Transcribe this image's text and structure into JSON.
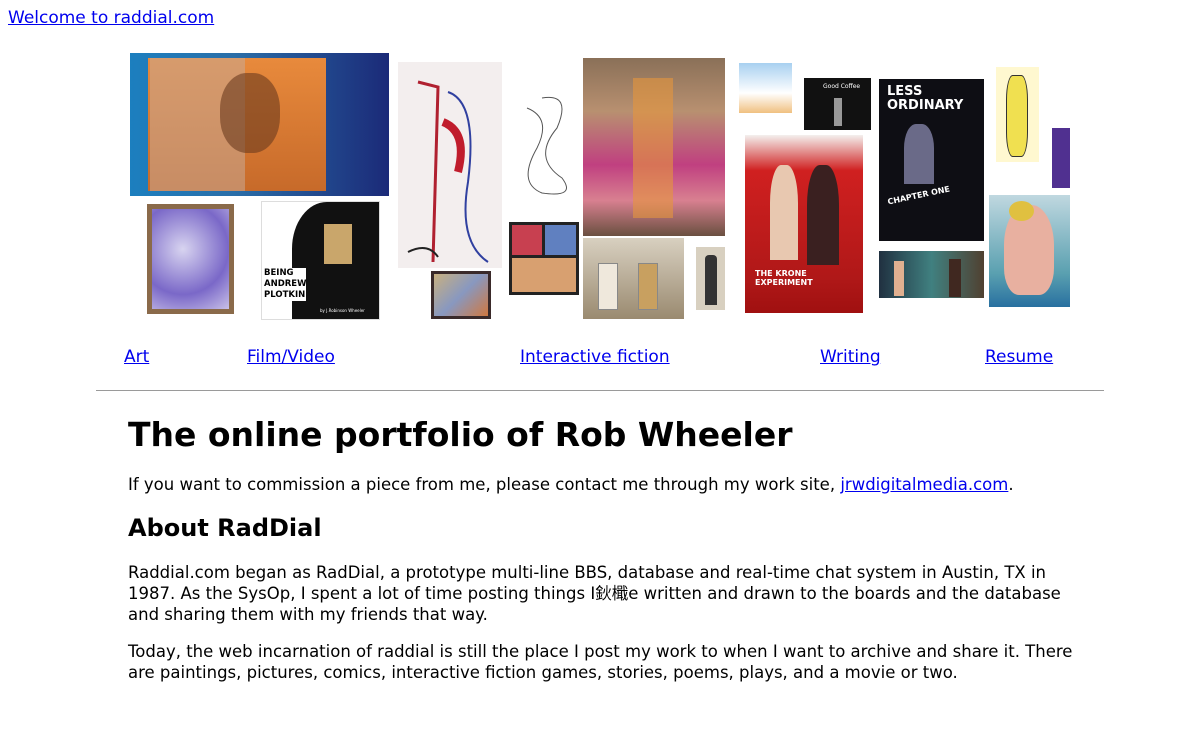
{
  "top_link": "Welcome to  raddial.com",
  "collage": {
    "plotkin_text": "BEING\nANDREW\nPLOTKIN",
    "plotkin_byline": "by J.Robinson Wheeler",
    "coffee_text": "Good Coffee",
    "krone_text": "THE KRONE EXPERIMENT",
    "less_ordinary_title": "LESS ORDINARY",
    "less_ordinary_sub": "CHAPTER ONE"
  },
  "nav": {
    "art": "Art",
    "film": "Film/Video",
    "if": "Interactive fiction",
    "writing": "Writing",
    "resume": "Resume"
  },
  "main": {
    "title": "The online portfolio of Rob Wheeler",
    "commission_before": "If you want to commission a piece from me, please contact me through my work site, ",
    "commission_link": "jrwdigitalmedia.com",
    "commission_after": ".",
    "about_heading": "About RadDial",
    "about_p1": "Raddial.com began as RadDial, a prototype multi-line BBS, database and real-time chat system in Austin, TX in 1987. As the SysOp, I spent a lot of time posting things I鈥檝e written and drawn to the boards and the database and sharing them with my friends that way.",
    "about_p2": "Today, the web incarnation of raddial is still the place I post my work to when I want to archive and share it. There are paintings, pictures, comics, interactive fiction games, stories, poems, plays, and a movie or two."
  }
}
